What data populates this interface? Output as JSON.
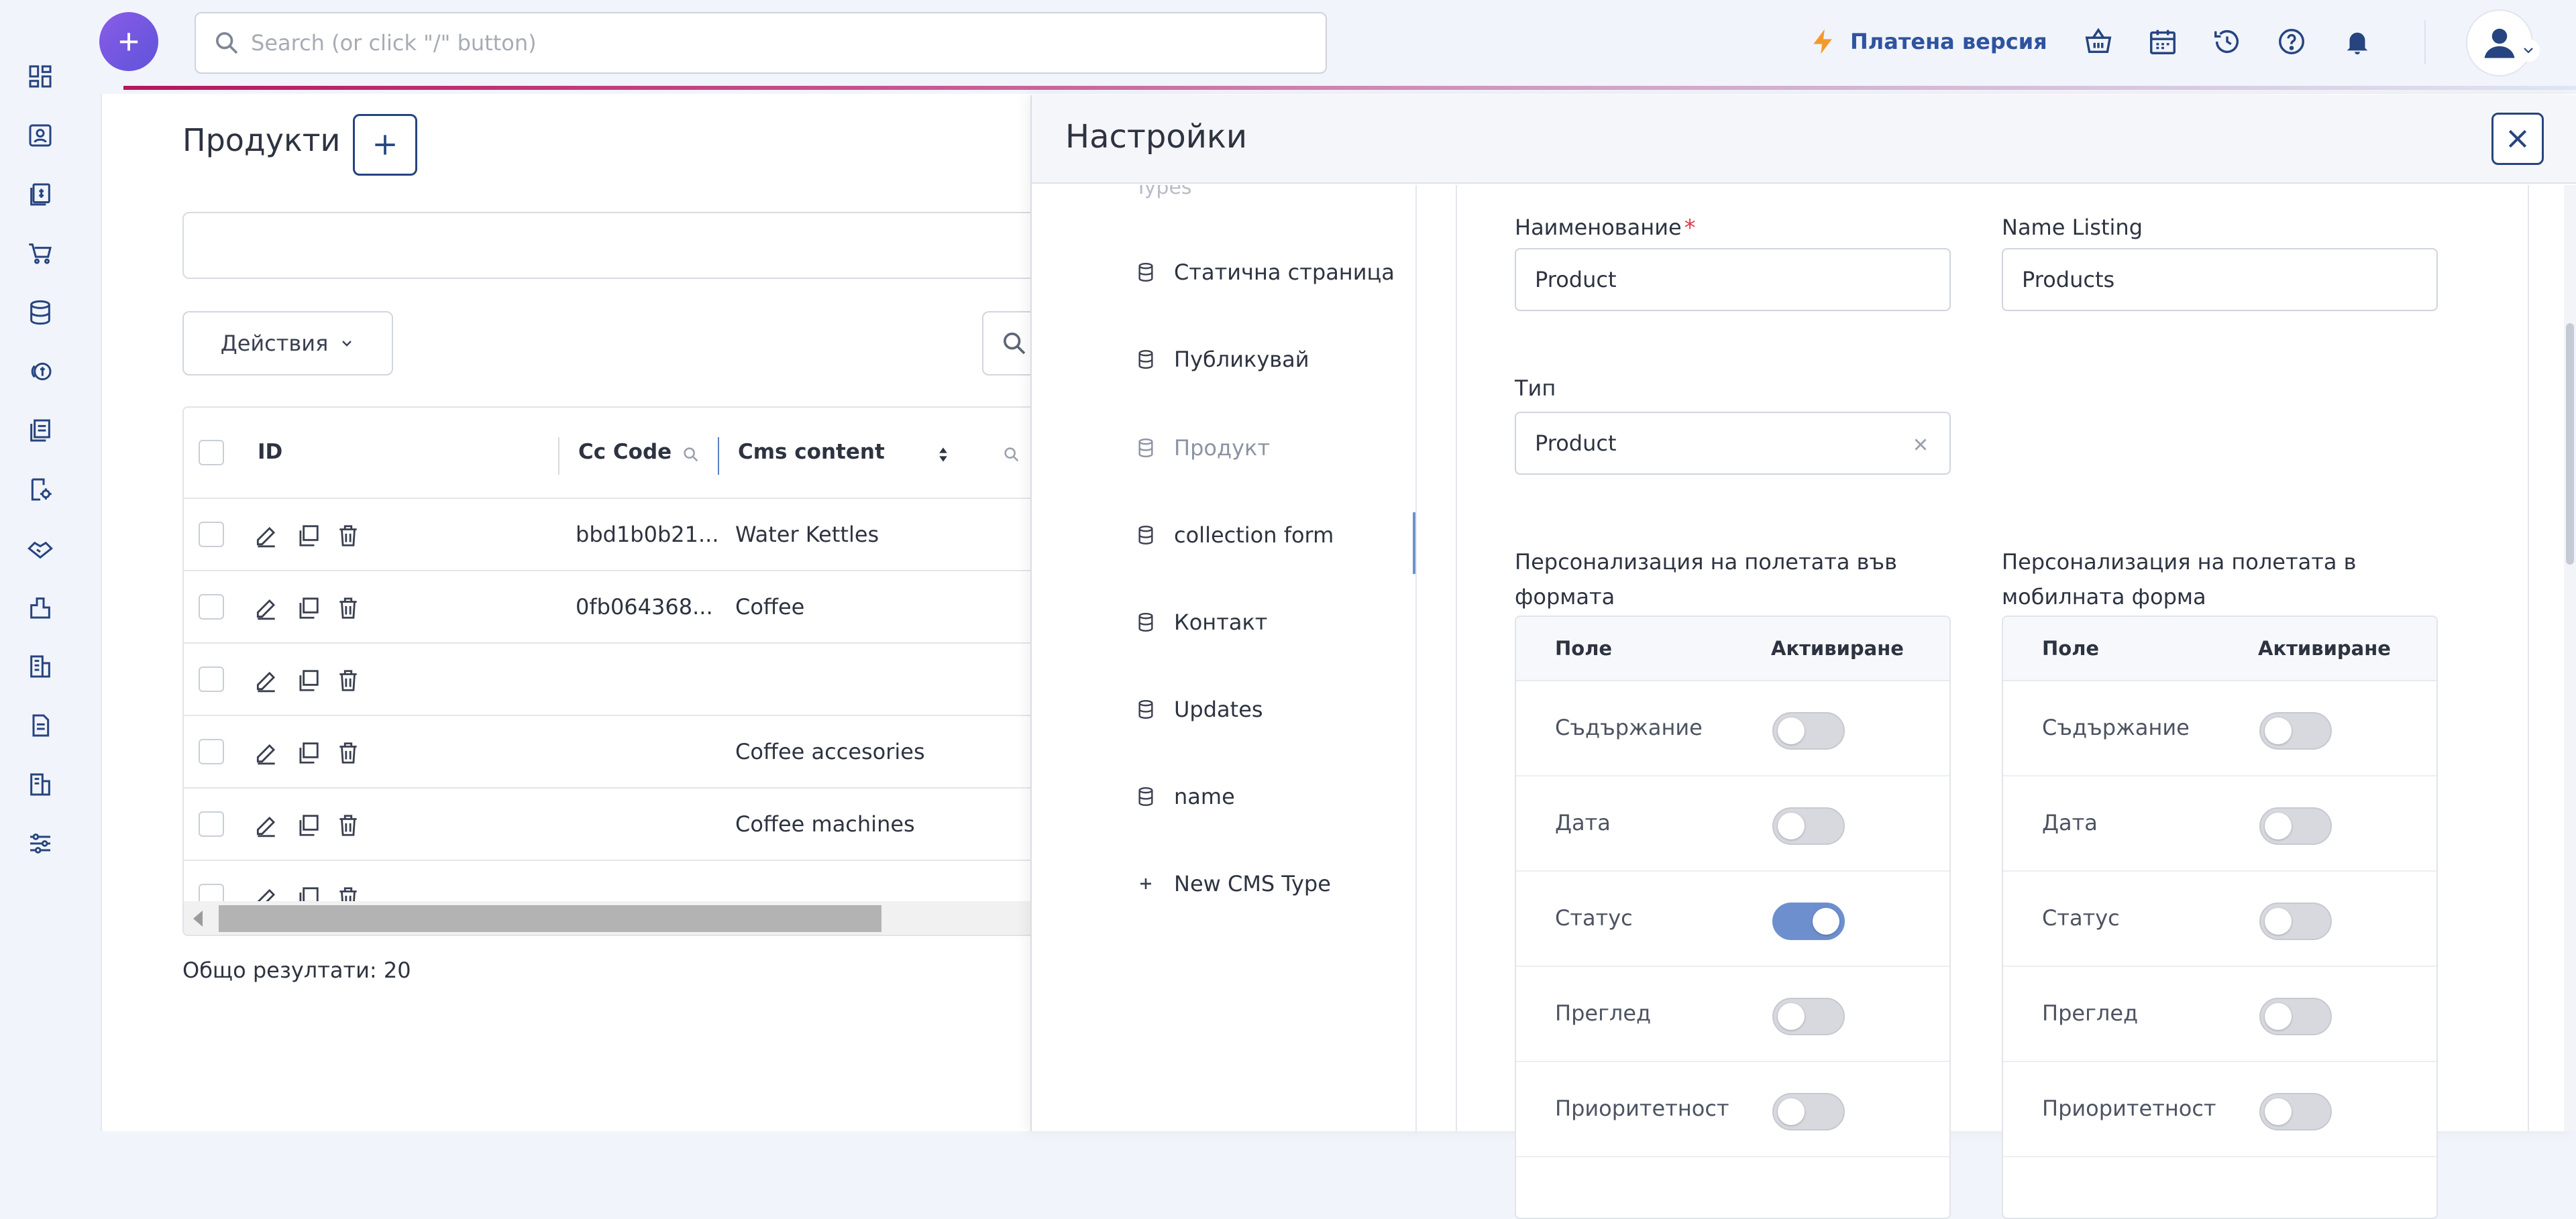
{
  "topbar": {
    "search_placeholder": "Search (or click \"/\" button)",
    "paid_label": "Платена версия"
  },
  "products": {
    "title": "Продукти",
    "actions_label": "Действия",
    "columns": [
      "ID",
      "Cc Code",
      "Cms content"
    ],
    "rows": [
      {
        "cc_code": "bbd1b0b21...",
        "content": "Water Kettles"
      },
      {
        "cc_code": "0fb064368...",
        "content": "Coffee"
      },
      {
        "cc_code": "",
        "content": ""
      },
      {
        "cc_code": "",
        "content": "Coffee accesories"
      },
      {
        "cc_code": "",
        "content": "Coffee machines"
      },
      {
        "cc_code": "",
        "content": ""
      }
    ],
    "total_label": "Общо резултати: 20"
  },
  "settings": {
    "title": "Настройки",
    "types_faded": "Types",
    "types": [
      {
        "label": "Статична страница",
        "icon": "database-icon",
        "active": false
      },
      {
        "label": "Публикувай",
        "icon": "database-icon",
        "active": false
      },
      {
        "label": "Продукт",
        "icon": "database-icon",
        "active": true
      },
      {
        "label": "collection form",
        "icon": "database-icon",
        "active": false
      },
      {
        "label": "Контакт",
        "icon": "database-icon",
        "active": false
      },
      {
        "label": "Updates",
        "icon": "database-icon",
        "active": false
      },
      {
        "label": "name",
        "icon": "database-icon",
        "active": false
      },
      {
        "label": "New CMS Type",
        "icon": "plus-icon",
        "active": false
      }
    ],
    "form": {
      "name_label": "Наименование",
      "name_value": "Product",
      "listing_label": "Name Listing",
      "listing_value": "Products",
      "type_label": "Тип",
      "type_value": "Product",
      "form_fields_label": "Персонализация на полетата във формата",
      "mobile_fields_label": "Персонализация на полетата в мобилната форма",
      "col_field": "Поле",
      "col_active": "Активиране",
      "fields": [
        "Съдържание",
        "Дата",
        "Статус",
        "Преглед",
        "Приоритетност"
      ],
      "form_toggles": [
        false,
        false,
        true,
        false,
        false
      ],
      "mobile_toggles": [
        false,
        false,
        false,
        false,
        false
      ]
    }
  },
  "colors": {
    "accent": "#26447f",
    "fab": "#7b5ae6",
    "toggle_on": "#6e8fce"
  }
}
